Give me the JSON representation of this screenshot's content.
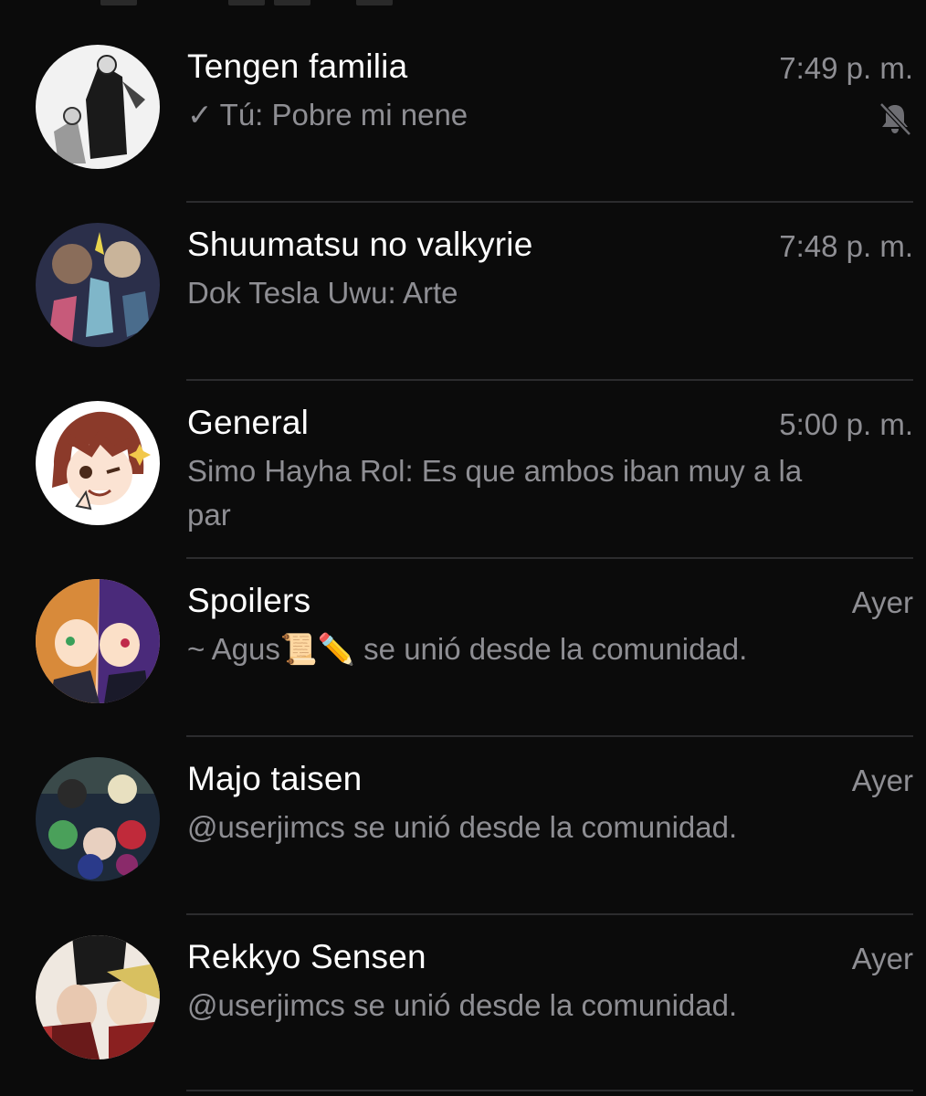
{
  "chats": [
    {
      "name": "Tengen familia",
      "time": "7:49 p. m.",
      "check": "✓",
      "sender": "Tú",
      "separator": ": ",
      "message": "Pobre mi nene",
      "muted": true,
      "avatar_icon": "manga-character-avatar"
    },
    {
      "name": "Shuumatsu no valkyrie",
      "time": "7:48 p. m.",
      "sender": "Dok Tesla Uwu",
      "separator": ": ",
      "message": "Arte",
      "avatar_icon": "anime-group-avatar"
    },
    {
      "name": "General",
      "time": "5:00 p. m.",
      "sender": "Simo Hayha Rol",
      "separator": ": ",
      "message": "Es que ambos iban muy a la par",
      "avatar_icon": "winking-girl-avatar"
    },
    {
      "name": "Spoilers",
      "time": "Ayer",
      "sender": "",
      "separator": "",
      "message": "~ Agus📜✏️ se unió desde la comunidad.",
      "avatar_icon": "anime-duo-avatar"
    },
    {
      "name": "Majo taisen",
      "time": "Ayer",
      "sender": "",
      "separator": "",
      "message": "@userjimcs se unió desde la comunidad.",
      "avatar_icon": "witch-group-avatar"
    },
    {
      "name": "Rekkyo Sensen",
      "time": "Ayer",
      "sender": "",
      "separator": "",
      "message": "@userjimcs se unió desde la comunidad.",
      "avatar_icon": "manga-cover-avatar"
    }
  ],
  "colors": {
    "background": "#0b0b0b",
    "title": "#ffffff",
    "secondary": "#8e8e93",
    "separator": "#2c2c2e"
  }
}
